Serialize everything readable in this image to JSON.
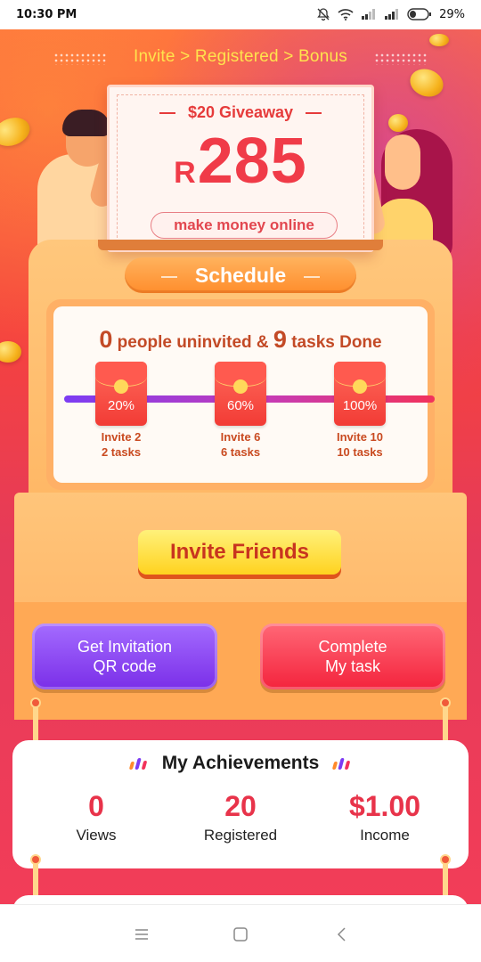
{
  "status_bar": {
    "time": "10:30 PM",
    "battery": "29%",
    "icons": [
      "mute-bell-icon",
      "wifi-icon",
      "signal-icon",
      "signal-icon",
      "battery-icon"
    ]
  },
  "banner": {
    "steps": "Invite >  Registered >  Bonus"
  },
  "ticket": {
    "title": "$20 Giveaway",
    "currency": "R",
    "amount": "285",
    "tagline": "make money online"
  },
  "schedule": {
    "title": "Schedule",
    "uninvited_count": "0",
    "uninvited_text": " people uninvited & ",
    "tasks_count": "9",
    "tasks_text": " tasks Done",
    "milestones": [
      {
        "percent": "20%",
        "line1": "Invite 2",
        "line2": "2 tasks"
      },
      {
        "percent": "60%",
        "line1": "Invite 6",
        "line2": "6 tasks"
      },
      {
        "percent": "100%",
        "line1": "Invite 10",
        "line2": "10 tasks"
      }
    ]
  },
  "actions": {
    "invite_friends": "Invite Friends",
    "qr_line1": "Get Invitation",
    "qr_line2": "QR code",
    "task_line1": "Complete",
    "task_line2": "My task"
  },
  "achievements": {
    "title": "My Achievements",
    "stats": [
      {
        "value": "0",
        "label": "Views"
      },
      {
        "value": "20",
        "label": "Registered"
      },
      {
        "value": "$1.00",
        "label": "Income"
      }
    ]
  },
  "colors": {
    "accent_red": "#e8334a",
    "accent_yellow": "#ffe34d",
    "purple_button": "#7a2ee8",
    "red_button": "#f4233c"
  },
  "navbar": {
    "icons": [
      "menu-icon",
      "home-square-icon",
      "back-chevron-icon"
    ]
  }
}
